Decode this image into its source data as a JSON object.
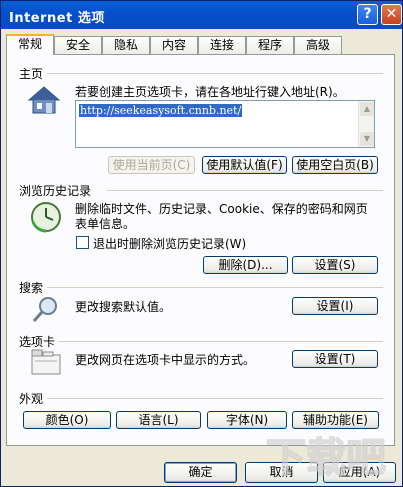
{
  "window": {
    "title": "Internet 选项",
    "help_label": "?",
    "close_label": "✕"
  },
  "tabs": [
    {
      "label": "常规"
    },
    {
      "label": "安全"
    },
    {
      "label": "隐私"
    },
    {
      "label": "内容"
    },
    {
      "label": "连接"
    },
    {
      "label": "程序"
    },
    {
      "label": "高级"
    }
  ],
  "home": {
    "title": "主页",
    "description": "若要创建主页选项卡，请在各地址行键入地址(R)。",
    "url": "http://seekeasysoft.cnnb.net/",
    "use_current": "使用当前页(C)",
    "use_default": "使用默认值(F)",
    "use_blank": "使用空白页(B)"
  },
  "history": {
    "title": "浏览历史记录",
    "description_line1": "删除临时文件、历史记录、Cookie、保存的密码和网页",
    "description_line2": "表单信息。",
    "checkbox_label": "退出时删除浏览历史记录(W)",
    "checkbox_checked": false,
    "delete_button": "删除(D)...",
    "settings_button": "设置(S)"
  },
  "search": {
    "title": "搜索",
    "description": "更改搜索默认值。",
    "settings_button": "设置(I)"
  },
  "tabs_section": {
    "title": "选项卡",
    "description": "更改网页在选项卡中显示的方式。",
    "settings_button": "设置(T)"
  },
  "appearance": {
    "title": "外观",
    "colors_button": "颜色(O)",
    "languages_button": "语言(L)",
    "fonts_button": "字体(N)",
    "accessibility_button": "辅助功能(E)"
  },
  "footer": {
    "ok": "确定",
    "cancel": "取消",
    "apply": "应用(A)"
  },
  "colors": {
    "titlebar": "#0550c9",
    "dialog_bg": "#ece9d8",
    "panel_bg": "#fcfcfe",
    "tab_accent": "#f8b134",
    "selection": "#316ac5"
  }
}
